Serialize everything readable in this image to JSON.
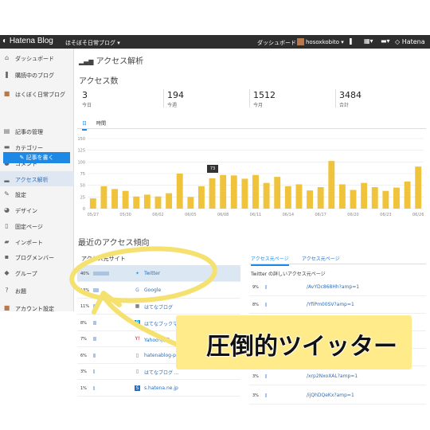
{
  "topbar": {
    "brand": "Hatena Blog",
    "blog_selector": "ほそぼそ日常ブログ ▾",
    "dashboard": "ダッシュボード",
    "username": "hosoxkobito ▾",
    "hatena": "Hatena"
  },
  "sidebar": {
    "items": [
      {
        "label": "ダッシュボード",
        "icon": "home-icon"
      },
      {
        "label": "購読中のブログ",
        "icon": "bookmark-icon"
      },
      {
        "label": "はくぼく日常ブログ",
        "icon": "blog-avatar"
      },
      {
        "label": "記事の管理",
        "icon": "document-icon"
      },
      {
        "label": "カテゴリー",
        "icon": "folder-icon"
      },
      {
        "label": "コメント",
        "icon": "comment-icon"
      },
      {
        "label": "アクセス解析",
        "icon": "chart-icon",
        "active": true
      },
      {
        "label": "設定",
        "icon": "wrench-icon"
      },
      {
        "label": "デザイン",
        "icon": "palette-icon"
      },
      {
        "label": "固定ページ",
        "icon": "page-icon"
      },
      {
        "label": "インポート",
        "icon": "truck-icon"
      },
      {
        "label": "ブログメンバー",
        "icon": "members-icon"
      },
      {
        "label": "グループ",
        "icon": "group-icon"
      },
      {
        "label": "お題",
        "icon": "question-icon"
      },
      {
        "label": "アカウント設定",
        "icon": "account-avatar"
      }
    ],
    "write_button": "記事を書く"
  },
  "main": {
    "page_title": "アクセス解析",
    "access_count_title": "アクセス数",
    "stats": [
      {
        "value": "3",
        "label": "今日"
      },
      {
        "value": "194",
        "label": "今週"
      },
      {
        "value": "1512",
        "label": "今月"
      },
      {
        "value": "3484",
        "label": "合計"
      }
    ],
    "tabs": [
      "日",
      "時間"
    ],
    "tooltip": "73",
    "recent_title": "最近のアクセス傾向",
    "referrer_header": "アクセス元サイト",
    "referrers": [
      {
        "pct": "40%",
        "name": "Twitter",
        "icon": "twitter-icon",
        "bar": 0.4,
        "highlight": true
      },
      {
        "pct": "13%",
        "name": "Google",
        "icon": "google-icon",
        "bar": 0.13
      },
      {
        "pct": "11%",
        "name": "はてなブログ",
        "icon": "hatena-blog-icon",
        "bar": 0.11
      },
      {
        "pct": "8%",
        "name": "はてなブックマーク",
        "icon": "hatena-bookmark-icon",
        "bar": 0.08
      },
      {
        "pct": "7%",
        "name": "Yahoo!検索",
        "icon": "yahoo-icon",
        "bar": 0.07
      },
      {
        "pct": "6%",
        "name": "hatenablog-parts",
        "icon": "page-icon",
        "bar": 0.06
      },
      {
        "pct": "3%",
        "name": "はてなブログ ...",
        "icon": "page-icon",
        "bar": 0.03
      },
      {
        "pct": "1%",
        "name": "s.hatena.ne.jp",
        "icon": "hatena-s-icon",
        "bar": 0.01
      }
    ],
    "right_tabs": [
      "アクセス元ページ",
      "アクセス元ページ"
    ],
    "twitter_title": "Twitter の詳しいアクセス元ページ",
    "twitter_pages": [
      {
        "pct": "9%",
        "url": "/AvYDc868Hh?amp=1"
      },
      {
        "pct": "8%",
        "url": "/YfiPm00SV?amp=1"
      },
      {
        "pct": "",
        "url": ""
      },
      {
        "pct": "",
        "url": ""
      },
      {
        "pct": "",
        "url": ""
      },
      {
        "pct": "3%",
        "url": "/xrp2NxoXAL?amp=1"
      },
      {
        "pct": "3%",
        "url": "/ijQhDQeKx?amp=1"
      }
    ]
  },
  "caption": "圧倒的ツイッター",
  "colors": {
    "bar": "#f0c33c",
    "accent": "#1e88e5",
    "highlight_ring": "#f5e170",
    "topbar": "#2e2e2e"
  },
  "chart_data": {
    "type": "bar",
    "categories": [
      "05/27",
      "05/28",
      "05/29",
      "05/30",
      "05/31",
      "06/01",
      "06/02",
      "06/03",
      "06/04",
      "06/05",
      "06/06",
      "06/07",
      "06/08",
      "06/09",
      "06/10",
      "06/11",
      "06/12",
      "06/13",
      "06/14",
      "06/15",
      "06/16",
      "06/17",
      "06/18",
      "06/19",
      "06/20",
      "06/21",
      "06/22",
      "06/23",
      "06/24",
      "06/25",
      "06/26"
    ],
    "tick_labels": [
      "05/27",
      "05/30",
      "06/02",
      "06/05",
      "06/08",
      "06/11",
      "06/14",
      "06/17",
      "06/20",
      "06/23",
      "06/26"
    ],
    "values": [
      22,
      48,
      42,
      38,
      26,
      30,
      26,
      33,
      75,
      25,
      48,
      65,
      72,
      71,
      64,
      72,
      55,
      68,
      48,
      52,
      39,
      46,
      102,
      52,
      40,
      55,
      46,
      38,
      45,
      58,
      90
    ],
    "ylim": [
      0,
      150
    ],
    "yticks": [
      0,
      25,
      50,
      75,
      100,
      125,
      150
    ],
    "grid": true
  }
}
